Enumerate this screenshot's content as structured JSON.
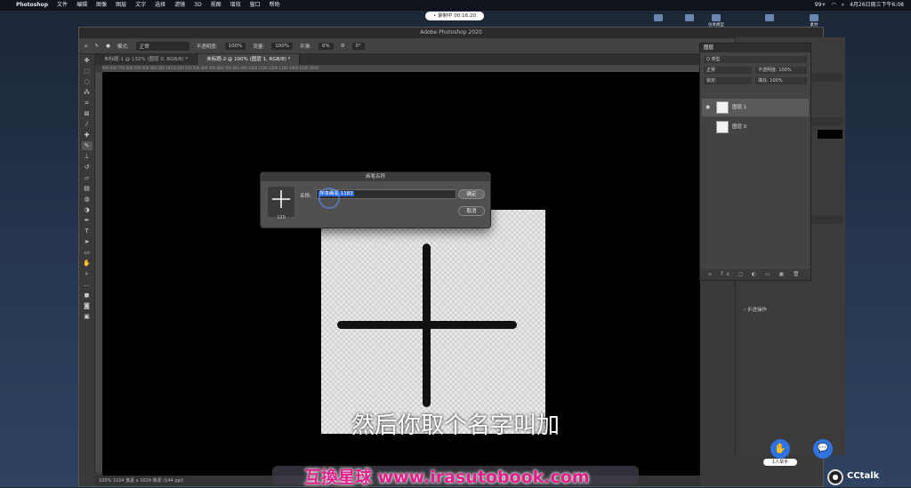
{
  "menubar": {
    "app_name": "Photoshop",
    "items": [
      "文件",
      "编辑",
      "图像",
      "图层",
      "文字",
      "选择",
      "滤镜",
      "3D",
      "视图",
      "增效",
      "窗口",
      "帮助"
    ],
    "battery": "99+",
    "clock": "4月26日周三下午6:08"
  },
  "recording_pill": "• 录制中 00:16:20",
  "desktop_icons": [
    "",
    "",
    "仿真模型",
    "",
    "素材"
  ],
  "photoshop": {
    "window_title": "Adobe Photoshop 2020",
    "options": {
      "mode_label": "模式:",
      "mode_value": "正常",
      "opacity_label": "不透明度:",
      "opacity_value": "100%",
      "flow_label": "流量:",
      "flow_value": "100%",
      "smoothing_label": "平滑:",
      "smoothing_value": "0%",
      "angle_value": "0°"
    },
    "tabs": [
      {
        "label": "未标题-1 @ 132% (图层 0, RGB/8) *",
        "active": false
      },
      {
        "label": "未标题-2 @ 100% (图层 1, RGB/8) *",
        "active": true
      }
    ],
    "ruler_ticks": "900  800  700  600  500  400  300  200  100  0  100  200  300  400  500  600  700  800  900  1000  1100  1200  1300  1400  1500  1600",
    "status": "100%   1024 像素 x 1024 像素 (144 ppi)"
  },
  "dialog": {
    "title": "画笔名称",
    "name_label": "名称:",
    "name_value": "样本画笔 1183",
    "brush_size": "120",
    "ok_label": "确定",
    "cancel_label": "取消"
  },
  "layers_panel": {
    "title": "图层",
    "filter_label": "Q 类型",
    "blend_mode": "正常",
    "opacity": "不透明度: 100%",
    "lock": "锁定:",
    "fill": "填充: 100%",
    "layers": [
      {
        "name": "图层 1",
        "selected": true
      },
      {
        "name": "图层 0",
        "selected": false
      }
    ],
    "footer_icons": "∞ fx ◻ ◐ ▭ ▣ 🗑"
  },
  "right_dock": {
    "history_label": "步进操作"
  },
  "subtitle": "然后你取个名字叫加",
  "watermark": "互換星球 www.irasutobook.com",
  "cctalk": {
    "hand_label": "1人举手",
    "logo_text": "CCtalk"
  }
}
